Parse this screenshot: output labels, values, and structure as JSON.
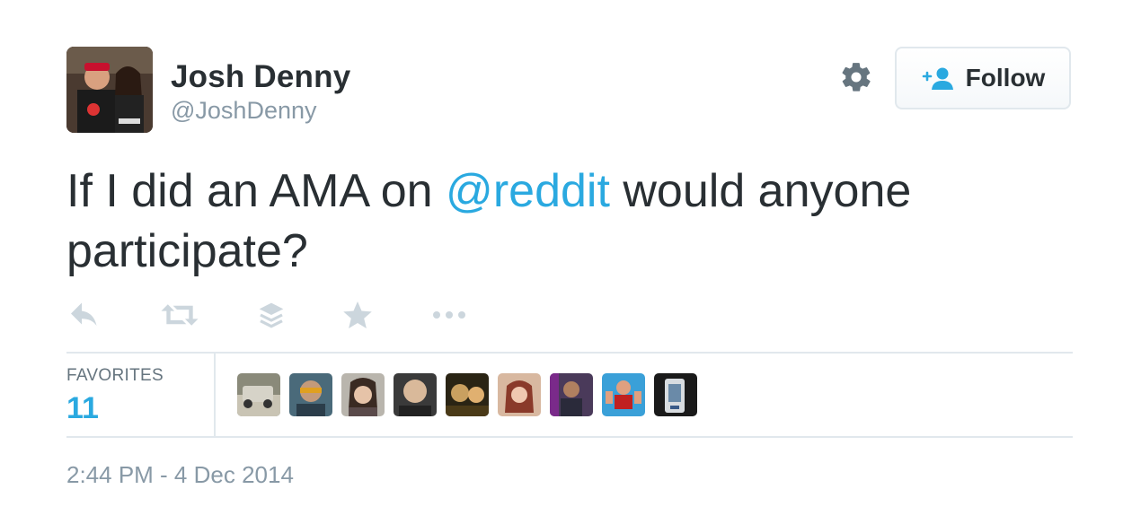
{
  "user": {
    "display_name": "Josh Denny",
    "username": "@JoshDenny",
    "avatar_icon": "profile-photo"
  },
  "header": {
    "settings_icon": "gear-icon",
    "follow": {
      "label": "Follow",
      "icon": "add-person-icon"
    }
  },
  "tweet": {
    "text_before": "If I did an AMA on ",
    "mention": "@reddit",
    "text_after": " would anyone participate?"
  },
  "actions": [
    "reply-icon",
    "retweet-icon",
    "buffer-icon",
    "favorite-star-icon",
    "more-dots-icon"
  ],
  "stats": {
    "favorites_label": "FAVORITES",
    "favorites_count": "11",
    "favoriter_avatars": 9
  },
  "timestamp": "2:44 PM - 4 Dec 2014",
  "colors": {
    "text": "#292f33",
    "muted": "#8899a6",
    "link": "#2aa9e0",
    "action_icon": "#ccd6dd",
    "border": "#e1e8ed"
  }
}
